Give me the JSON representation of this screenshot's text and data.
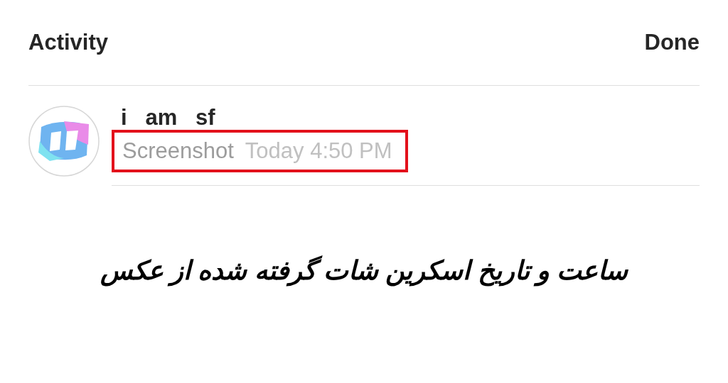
{
  "header": {
    "title": "Activity",
    "done": "Done"
  },
  "activity": {
    "username": "i   am   sf",
    "action": "Screenshot",
    "time": "Today 4:50 PM",
    "highlighted": true
  },
  "caption": "ساعت و تاریخ اسکرین شات گرفته شده از عکس"
}
